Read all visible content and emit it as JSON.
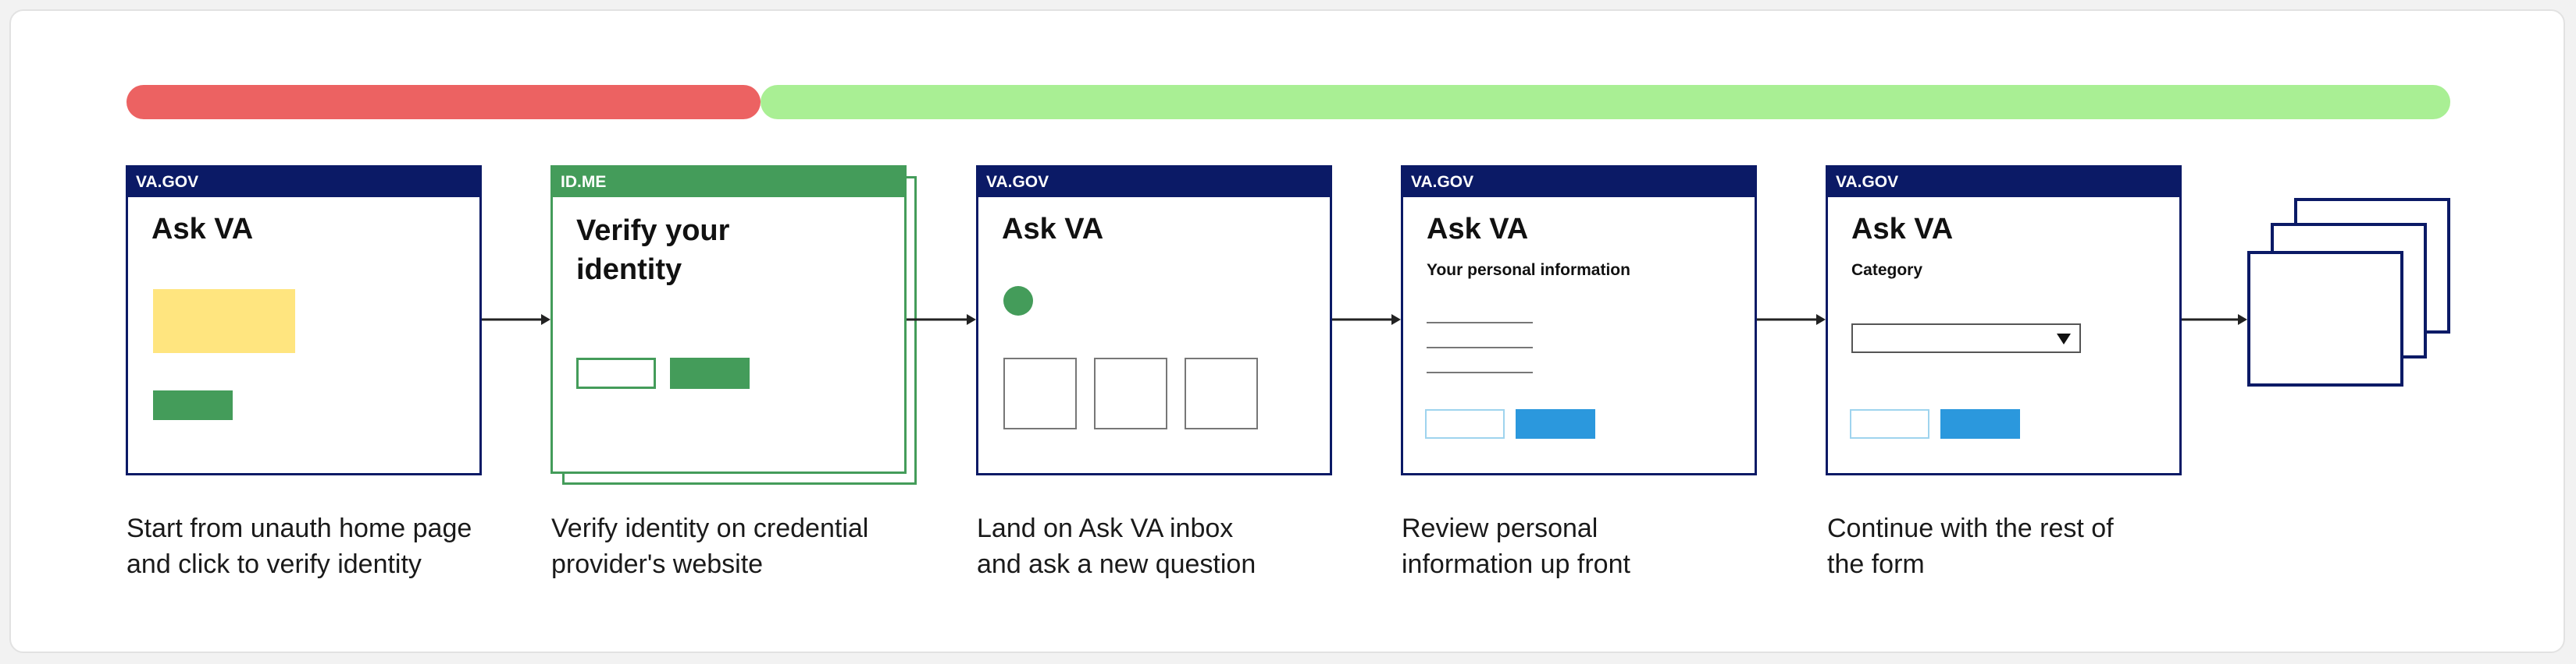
{
  "colors": {
    "navy": "#0b1a66",
    "green": "#449c5a",
    "red": "#ec6262",
    "light_green": "#a9ef94",
    "yellow": "#ffe57f",
    "blue": "#2b98dd",
    "light_blue": "#9fd4ee"
  },
  "steps": [
    {
      "header": "VA.GOV",
      "title": "Ask VA",
      "caption": "Start from unauth home page\nand click to verify identity"
    },
    {
      "header": "ID.ME",
      "title": "Verify your\nidentity",
      "caption": "Verify identity on credential\nprovider's website"
    },
    {
      "header": "VA.GOV",
      "title": "Ask VA",
      "caption": "Land on Ask VA inbox\nand ask a new question"
    },
    {
      "header": "VA.GOV",
      "title": "Ask VA",
      "subtitle": "Your personal information",
      "caption": "Review personal\ninformation up front"
    },
    {
      "header": "VA.GOV",
      "title": "Ask VA",
      "subtitle": "Category",
      "caption": "Continue with the rest of\nthe form"
    }
  ],
  "icons": {
    "dropdown": "triangle-down-icon",
    "pages": "stacked-pages-icon"
  }
}
